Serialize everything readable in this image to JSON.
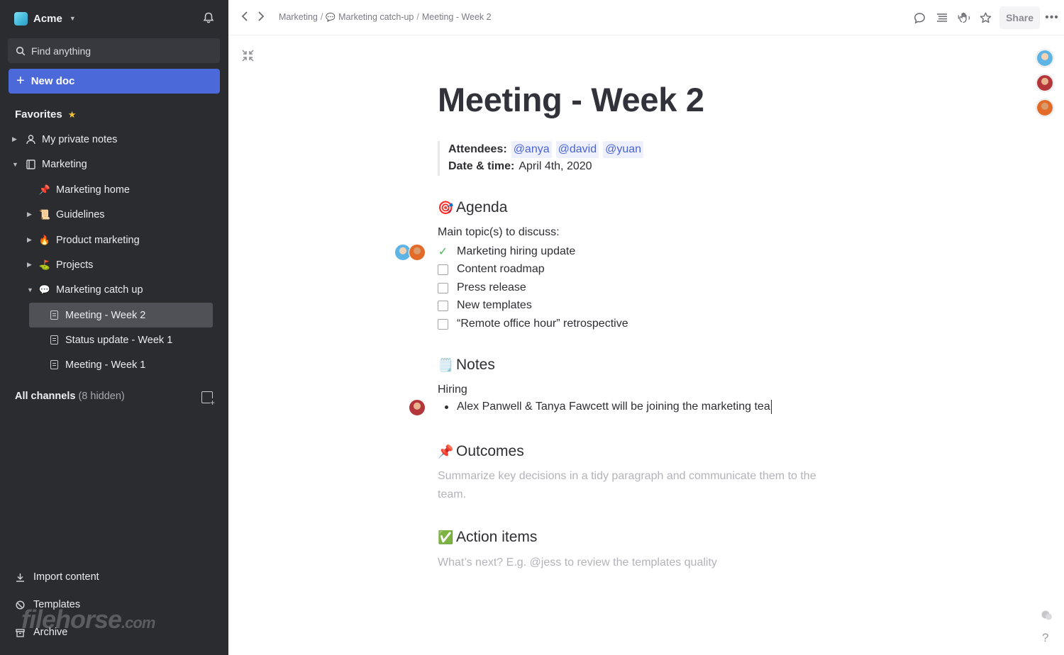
{
  "workspace": {
    "name": "Acme"
  },
  "search": {
    "label": "Find anything"
  },
  "new_doc": {
    "label": "New doc"
  },
  "favorites": {
    "title": "Favorites"
  },
  "nav": {
    "items": [
      {
        "label": "My private notes",
        "icon": "person-icon"
      },
      {
        "label": "Marketing",
        "icon": "book-icon"
      },
      {
        "label": "Marketing home",
        "icon": "pushpin-emoji"
      },
      {
        "label": "Guidelines",
        "icon": "scroll-emoji"
      },
      {
        "label": "Product marketing",
        "icon": "fire-emoji"
      },
      {
        "label": "Projects",
        "icon": "golf-emoji"
      },
      {
        "label": "Marketing catch up",
        "icon": "speech-bubble-emoji"
      },
      {
        "label": "Meeting - Week 2",
        "icon": "doc-icon",
        "selected": true
      },
      {
        "label": "Status update - Week 1",
        "icon": "doc-icon"
      },
      {
        "label": "Meeting - Week 1",
        "icon": "doc-icon"
      }
    ]
  },
  "channels": {
    "label": "All channels",
    "hidden": "(8 hidden)"
  },
  "bottom": {
    "import": "Import content",
    "templates": "Templates",
    "archive": "Archive"
  },
  "watermark": {
    "text": "filehorse",
    "suffix": ".com"
  },
  "breadcrumb": {
    "part1": "Marketing",
    "sep1": "/",
    "part2": "Marketing catch-up",
    "sep2": "/",
    "part3": "Meeting - Week 2"
  },
  "toolbar": {
    "share": "Share"
  },
  "doc": {
    "title": "Meeting - Week 2",
    "attendees_label": "Attendees:",
    "attendees": [
      "@anya",
      "@david",
      "@yuan"
    ],
    "date_label": "Date & time:",
    "date_value": "April 4th, 2020",
    "agenda": {
      "heading": "Agenda",
      "intro": "Main topic(s) to discuss:",
      "items": [
        {
          "text": "Marketing hiring update",
          "done": true
        },
        {
          "text": "Content roadmap",
          "done": false
        },
        {
          "text": "Press release",
          "done": false
        },
        {
          "text": "New templates",
          "done": false
        },
        {
          "text": "“Remote office hour” retrospective",
          "done": false
        }
      ]
    },
    "notes": {
      "heading": "Notes",
      "sub": "Hiring",
      "bullet": "Alex Panwell & Tanya Fawcett will be joining the marketing tea"
    },
    "outcomes": {
      "heading": "Outcomes",
      "placeholder": "Summarize key decisions in a tidy paragraph and communicate them to the team."
    },
    "action_items": {
      "heading": "Action items",
      "placeholder": "What’s next? E.g. @jess to review the templates quality"
    }
  },
  "help": {
    "label": "?"
  },
  "colors": {
    "sidebar_bg": "#2b2c30",
    "accent": "#4c69d9",
    "mention": "#4a63d6",
    "done_check": "#45b95a"
  }
}
